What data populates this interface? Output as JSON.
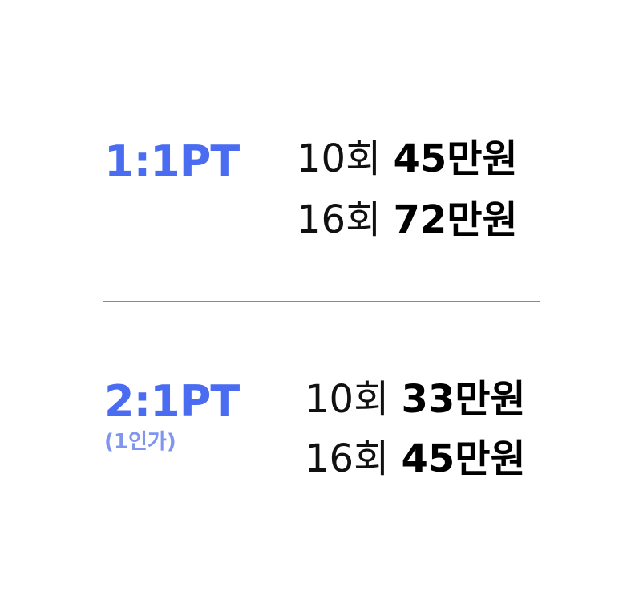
{
  "colors": {
    "accent": "#4a6cf0",
    "accent_light": "#7f95ef",
    "divider": "#6b86ef"
  },
  "plans": [
    {
      "title": "1:1PT",
      "note": "",
      "prices": [
        {
          "sessions": "10회",
          "price": "45만원"
        },
        {
          "sessions": "16회",
          "price": "72만원"
        }
      ]
    },
    {
      "title": "2:1PT",
      "note": "(1인가)",
      "prices": [
        {
          "sessions": "10회",
          "price": "33만원"
        },
        {
          "sessions": "16회",
          "price": "45만원"
        }
      ]
    }
  ]
}
